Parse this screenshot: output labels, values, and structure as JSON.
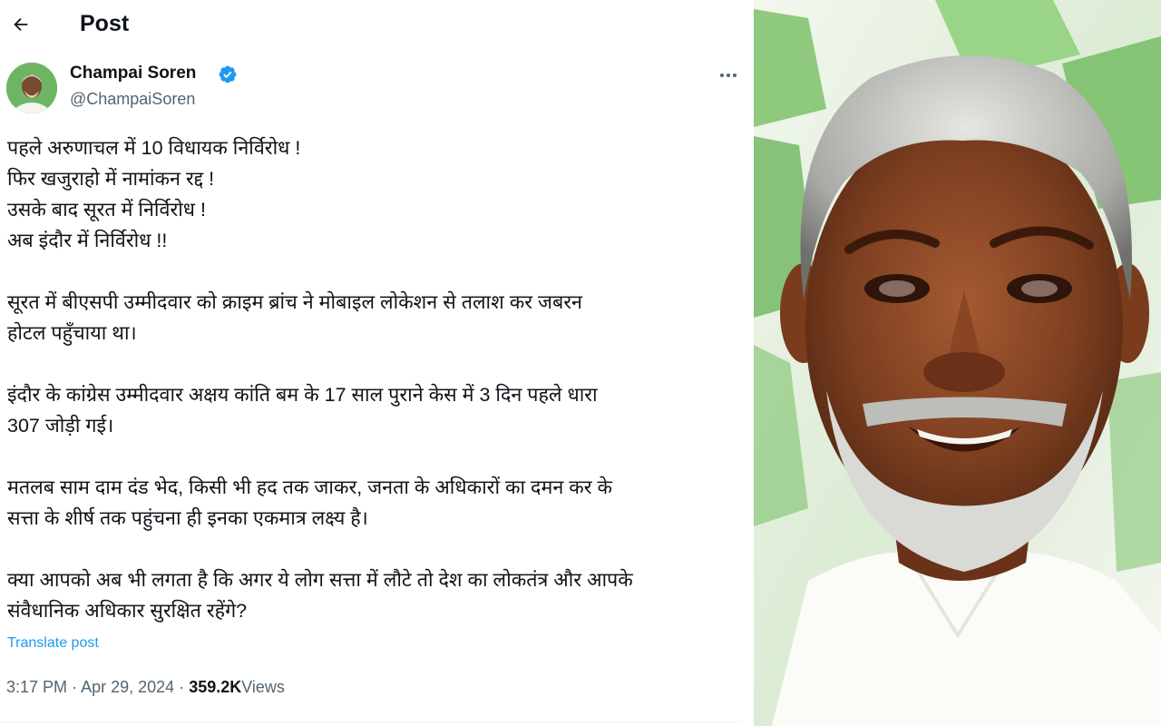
{
  "header": {
    "title": "Post",
    "back_icon": "arrow-left-icon"
  },
  "author": {
    "name": "Champai Soren",
    "handle": "@ChampaiSoren",
    "verified": true,
    "verified_color": "#1d9bf0"
  },
  "post": {
    "paragraphs": [
      [
        "पहले अरुणाचल में 10 विधायक निर्विरोध !",
        "फिर खजुराहो में नामांकन रद्द !",
        "उसके बाद सूरत में निर्विरोध !",
        "अब इंदौर में निर्विरोध !!"
      ],
      [
        "सूरत में बीएसपी उम्मीदवार को क्राइम ब्रांच ने मोबाइल लोकेशन से तलाश कर जबरन",
        "होटल पहुँचाया था।"
      ],
      [
        "इंदौर के कांग्रेस उम्मीदवार अक्षय कांति बम के 17 साल पुराने केस में 3 दिन पहले धारा",
        "307 जोड़ी गई।"
      ],
      [
        "मतलब साम दाम दंड भेद, किसी भी हद तक जाकर, जनता के अधिकारों का दमन कर के",
        "सत्ता के शीर्ष तक पहुंचना ही इनका एकमात्र लक्ष्य है।"
      ],
      [
        "क्या आपको अब भी लगता है कि अगर ये लोग सत्ता में लौटे तो देश का लोकतंत्र और आपके",
        "संवैधानिक अधिकार सुरक्षित रहेंगे?"
      ]
    ],
    "translate_label": "Translate post"
  },
  "meta": {
    "time": "3:17 PM",
    "separator": "·",
    "date": "Apr 29, 2024",
    "views_count": "359.2K",
    "views_label": "Views"
  },
  "colors": {
    "link": "#1d9bf0",
    "secondary_text": "#536471",
    "primary_text": "#0f1419",
    "photo_bg_green": "#7cc16a"
  }
}
